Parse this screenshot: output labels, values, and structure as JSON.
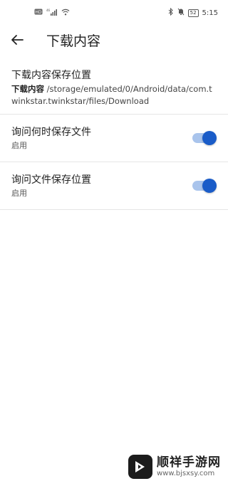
{
  "status_bar": {
    "left_icons": [
      "hd-icon",
      "signal-icon",
      "wifi-icon"
    ],
    "left_labels": [
      "HD",
      "46",
      "",
      ""
    ],
    "right_icons": [
      "bluetooth-icon",
      "mute-icon",
      "battery-icon"
    ],
    "battery_level": "52",
    "time": "5:15"
  },
  "header": {
    "title": "下载内容",
    "back_icon": "arrow-left-icon"
  },
  "settings": {
    "location": {
      "title": "下载内容保存位置",
      "path_prefix": "下载内容",
      "path": " /storage/emulated/0/Android/data/com.twinkstar.twinkstar/files/Download"
    },
    "ask_each_time": {
      "title": "询问何时保存文件",
      "status": "启用",
      "enabled": true
    },
    "ask_location": {
      "title": "询问文件保存位置",
      "status": "启用",
      "enabled": true
    }
  },
  "watermark": {
    "title": "顺祥手游网",
    "url": "www.bjsxsy.com"
  },
  "colors": {
    "accent": "#1a5cc8",
    "track": "#a9c4ec"
  }
}
